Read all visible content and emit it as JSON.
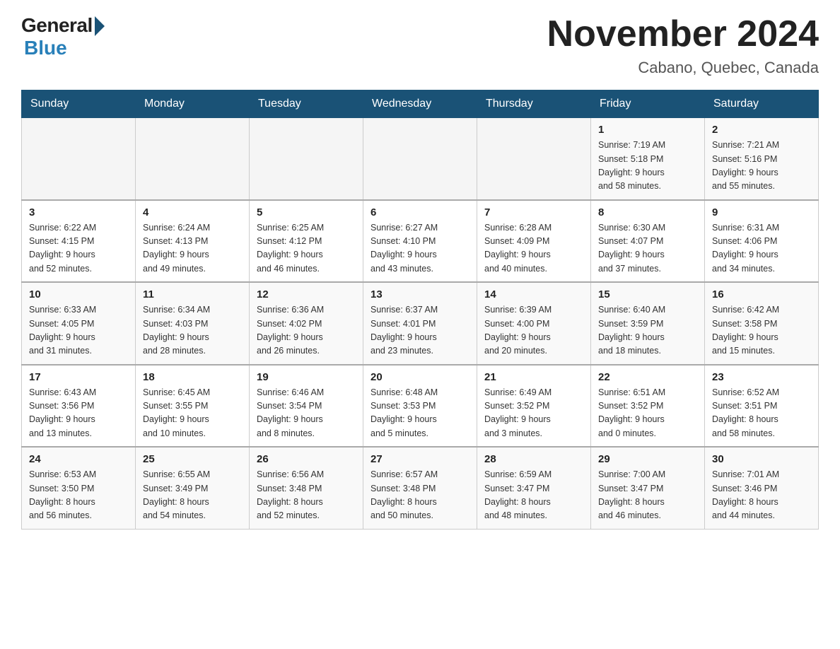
{
  "logo": {
    "general": "General",
    "blue": "Blue"
  },
  "title": "November 2024",
  "subtitle": "Cabano, Quebec, Canada",
  "weekdays": [
    "Sunday",
    "Monday",
    "Tuesday",
    "Wednesday",
    "Thursday",
    "Friday",
    "Saturday"
  ],
  "weeks": [
    [
      {
        "day": "",
        "info": ""
      },
      {
        "day": "",
        "info": ""
      },
      {
        "day": "",
        "info": ""
      },
      {
        "day": "",
        "info": ""
      },
      {
        "day": "",
        "info": ""
      },
      {
        "day": "1",
        "info": "Sunrise: 7:19 AM\nSunset: 5:18 PM\nDaylight: 9 hours\nand 58 minutes."
      },
      {
        "day": "2",
        "info": "Sunrise: 7:21 AM\nSunset: 5:16 PM\nDaylight: 9 hours\nand 55 minutes."
      }
    ],
    [
      {
        "day": "3",
        "info": "Sunrise: 6:22 AM\nSunset: 4:15 PM\nDaylight: 9 hours\nand 52 minutes."
      },
      {
        "day": "4",
        "info": "Sunrise: 6:24 AM\nSunset: 4:13 PM\nDaylight: 9 hours\nand 49 minutes."
      },
      {
        "day": "5",
        "info": "Sunrise: 6:25 AM\nSunset: 4:12 PM\nDaylight: 9 hours\nand 46 minutes."
      },
      {
        "day": "6",
        "info": "Sunrise: 6:27 AM\nSunset: 4:10 PM\nDaylight: 9 hours\nand 43 minutes."
      },
      {
        "day": "7",
        "info": "Sunrise: 6:28 AM\nSunset: 4:09 PM\nDaylight: 9 hours\nand 40 minutes."
      },
      {
        "day": "8",
        "info": "Sunrise: 6:30 AM\nSunset: 4:07 PM\nDaylight: 9 hours\nand 37 minutes."
      },
      {
        "day": "9",
        "info": "Sunrise: 6:31 AM\nSunset: 4:06 PM\nDaylight: 9 hours\nand 34 minutes."
      }
    ],
    [
      {
        "day": "10",
        "info": "Sunrise: 6:33 AM\nSunset: 4:05 PM\nDaylight: 9 hours\nand 31 minutes."
      },
      {
        "day": "11",
        "info": "Sunrise: 6:34 AM\nSunset: 4:03 PM\nDaylight: 9 hours\nand 28 minutes."
      },
      {
        "day": "12",
        "info": "Sunrise: 6:36 AM\nSunset: 4:02 PM\nDaylight: 9 hours\nand 26 minutes."
      },
      {
        "day": "13",
        "info": "Sunrise: 6:37 AM\nSunset: 4:01 PM\nDaylight: 9 hours\nand 23 minutes."
      },
      {
        "day": "14",
        "info": "Sunrise: 6:39 AM\nSunset: 4:00 PM\nDaylight: 9 hours\nand 20 minutes."
      },
      {
        "day": "15",
        "info": "Sunrise: 6:40 AM\nSunset: 3:59 PM\nDaylight: 9 hours\nand 18 minutes."
      },
      {
        "day": "16",
        "info": "Sunrise: 6:42 AM\nSunset: 3:58 PM\nDaylight: 9 hours\nand 15 minutes."
      }
    ],
    [
      {
        "day": "17",
        "info": "Sunrise: 6:43 AM\nSunset: 3:56 PM\nDaylight: 9 hours\nand 13 minutes."
      },
      {
        "day": "18",
        "info": "Sunrise: 6:45 AM\nSunset: 3:55 PM\nDaylight: 9 hours\nand 10 minutes."
      },
      {
        "day": "19",
        "info": "Sunrise: 6:46 AM\nSunset: 3:54 PM\nDaylight: 9 hours\nand 8 minutes."
      },
      {
        "day": "20",
        "info": "Sunrise: 6:48 AM\nSunset: 3:53 PM\nDaylight: 9 hours\nand 5 minutes."
      },
      {
        "day": "21",
        "info": "Sunrise: 6:49 AM\nSunset: 3:52 PM\nDaylight: 9 hours\nand 3 minutes."
      },
      {
        "day": "22",
        "info": "Sunrise: 6:51 AM\nSunset: 3:52 PM\nDaylight: 9 hours\nand 0 minutes."
      },
      {
        "day": "23",
        "info": "Sunrise: 6:52 AM\nSunset: 3:51 PM\nDaylight: 8 hours\nand 58 minutes."
      }
    ],
    [
      {
        "day": "24",
        "info": "Sunrise: 6:53 AM\nSunset: 3:50 PM\nDaylight: 8 hours\nand 56 minutes."
      },
      {
        "day": "25",
        "info": "Sunrise: 6:55 AM\nSunset: 3:49 PM\nDaylight: 8 hours\nand 54 minutes."
      },
      {
        "day": "26",
        "info": "Sunrise: 6:56 AM\nSunset: 3:48 PM\nDaylight: 8 hours\nand 52 minutes."
      },
      {
        "day": "27",
        "info": "Sunrise: 6:57 AM\nSunset: 3:48 PM\nDaylight: 8 hours\nand 50 minutes."
      },
      {
        "day": "28",
        "info": "Sunrise: 6:59 AM\nSunset: 3:47 PM\nDaylight: 8 hours\nand 48 minutes."
      },
      {
        "day": "29",
        "info": "Sunrise: 7:00 AM\nSunset: 3:47 PM\nDaylight: 8 hours\nand 46 minutes."
      },
      {
        "day": "30",
        "info": "Sunrise: 7:01 AM\nSunset: 3:46 PM\nDaylight: 8 hours\nand 44 minutes."
      }
    ]
  ]
}
